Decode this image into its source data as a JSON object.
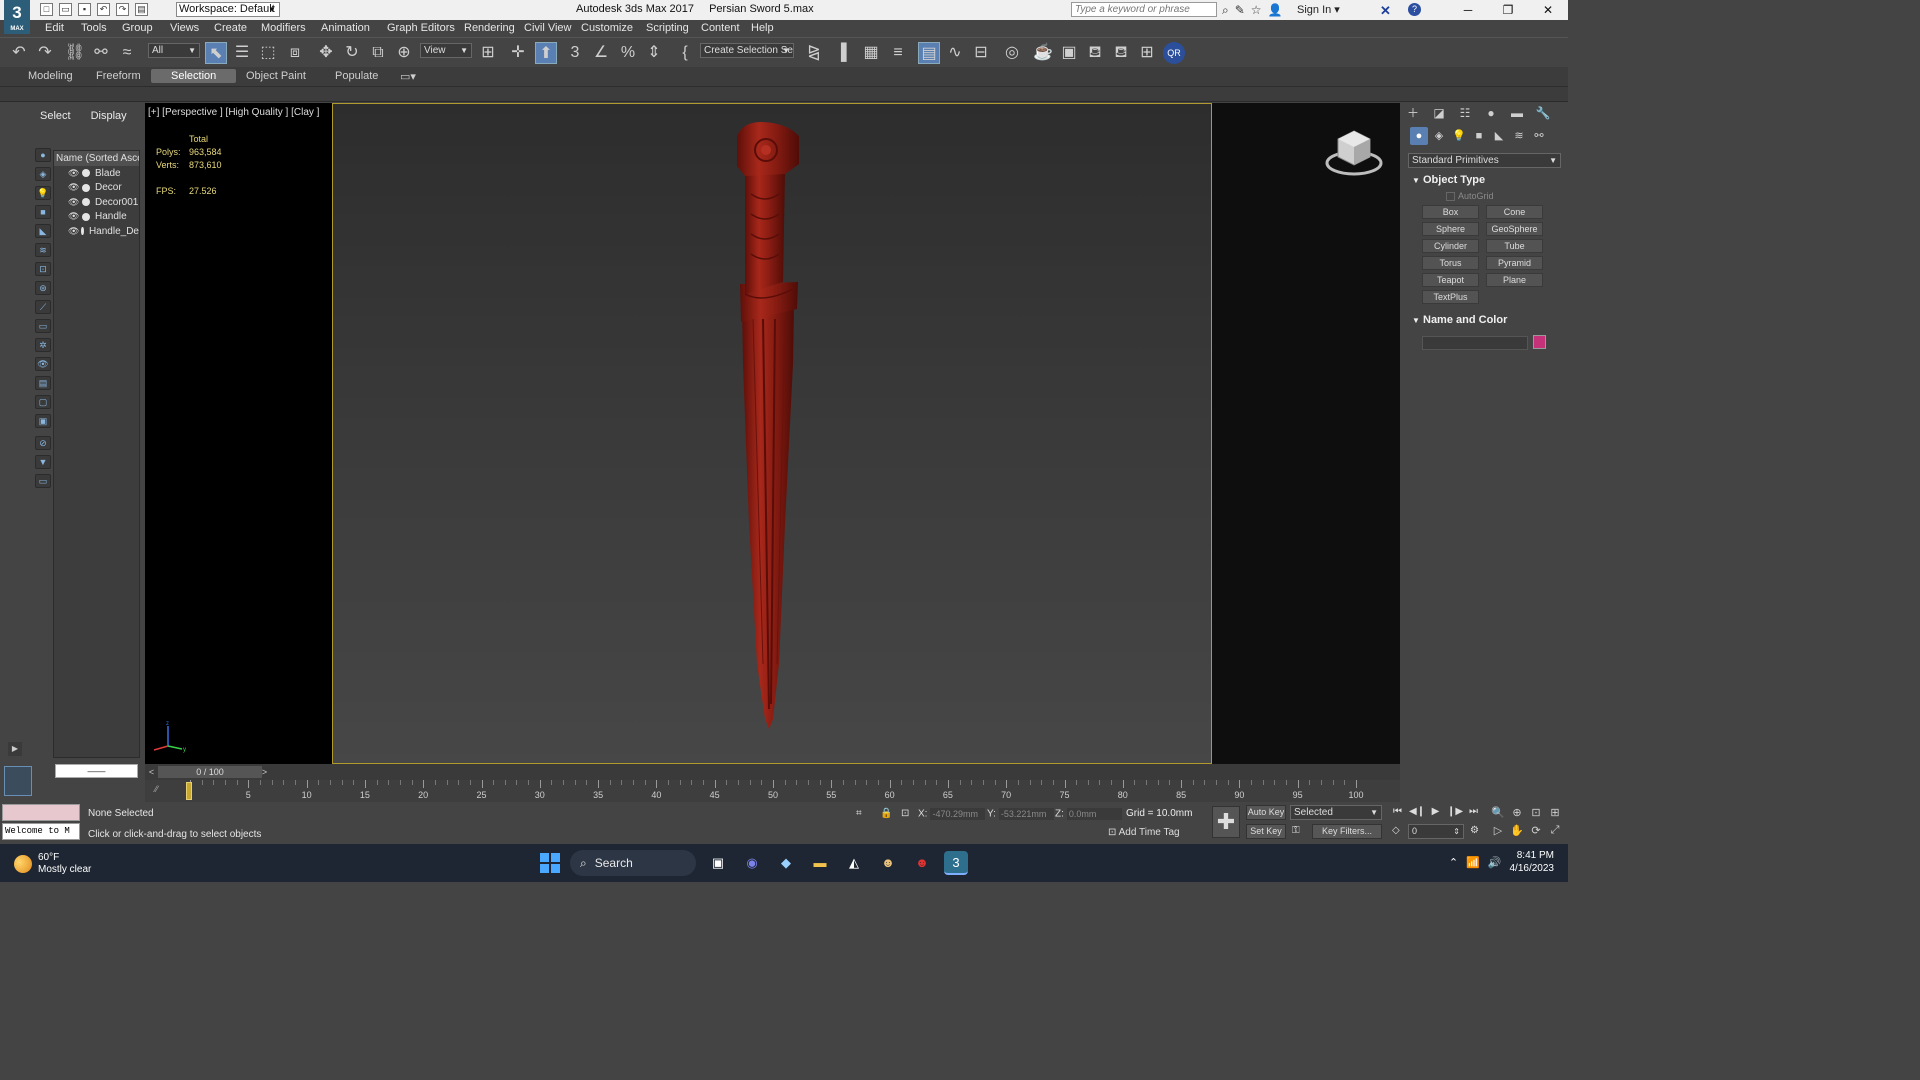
{
  "titlebar": {
    "app_icon": "3",
    "app_icon_sub": "MAX",
    "workspace": "Workspace: Default",
    "app_name": "Autodesk 3ds Max 2017",
    "file_name": "Persian Sword 5.max",
    "search_placeholder": "Type a keyword or phrase",
    "sign_in": "Sign In"
  },
  "menu": [
    {
      "label": "Edit"
    },
    {
      "label": "Tools"
    },
    {
      "label": "Group"
    },
    {
      "label": "Views"
    },
    {
      "label": "Create"
    },
    {
      "label": "Modifiers"
    },
    {
      "label": "Animation"
    },
    {
      "label": "Graph Editors"
    },
    {
      "label": "Rendering"
    },
    {
      "label": "Civil View"
    },
    {
      "label": "Customize"
    },
    {
      "label": "Scripting"
    },
    {
      "label": "Content"
    },
    {
      "label": "Help"
    }
  ],
  "toolbar": {
    "filter": "All",
    "ref_coord": "View",
    "named_selection": "Create Selection Se",
    "qr_badge": "QR"
  },
  "ribbon": {
    "tabs": [
      "Modeling",
      "Freeform",
      "Selection",
      "Object Paint",
      "Populate"
    ],
    "active_tab": "Selection"
  },
  "scene_explorer": {
    "tabs": [
      "Select",
      "Display"
    ],
    "column_header": "Name (Sorted Ascen",
    "objects": [
      "Blade",
      "Decor",
      "Decor001",
      "Handle",
      "Handle_De"
    ],
    "bottom_field": "——"
  },
  "viewport": {
    "label": "[+] [Perspective ] [High Quality ] [Clay ]",
    "stats_header": "Total",
    "polys_label": "Polys:",
    "polys": "963,584",
    "verts_label": "Verts:",
    "verts": "873,610",
    "fps_label": "FPS:",
    "fps": "27.526",
    "model_color": "#8e1b12"
  },
  "command_panel": {
    "category": "Standard Primitives",
    "object_type_title": "Object Type",
    "autogrid": "AutoGrid",
    "buttons": [
      "Box",
      "Cone",
      "Sphere",
      "GeoSphere",
      "Cylinder",
      "Tube",
      "Torus",
      "Pyramid",
      "Teapot",
      "Plane",
      "TextPlus"
    ],
    "name_color_title": "Name and Color",
    "object_color": "#c5327a"
  },
  "timeline": {
    "frame_display": "0 / 100",
    "ticks": [
      "5",
      "10",
      "15",
      "20",
      "25",
      "30",
      "35",
      "40",
      "45",
      "50",
      "55",
      "60",
      "65",
      "70",
      "75",
      "80",
      "85",
      "90",
      "95",
      "100"
    ]
  },
  "status": {
    "selection": "None Selected",
    "prompt": "Click or click-and-drag to select objects",
    "listener_text": "Welcome to M",
    "x_label": "X:",
    "x_value": "-470.29mm",
    "y_label": "Y:",
    "y_value": "-53.221mm",
    "z_label": "Z:",
    "z_value": "0.0mm",
    "grid": "Grid = 10.0mm",
    "add_time_tag": "Add Time Tag",
    "auto_key": "Auto Key",
    "set_key": "Set Key",
    "selected": "Selected",
    "key_filters": "Key Filters...",
    "frame": "0"
  },
  "taskbar": {
    "temperature": "60°F",
    "weather": "Mostly clear",
    "search": "Search",
    "time": "8:41 PM",
    "date": "4/16/2023"
  }
}
